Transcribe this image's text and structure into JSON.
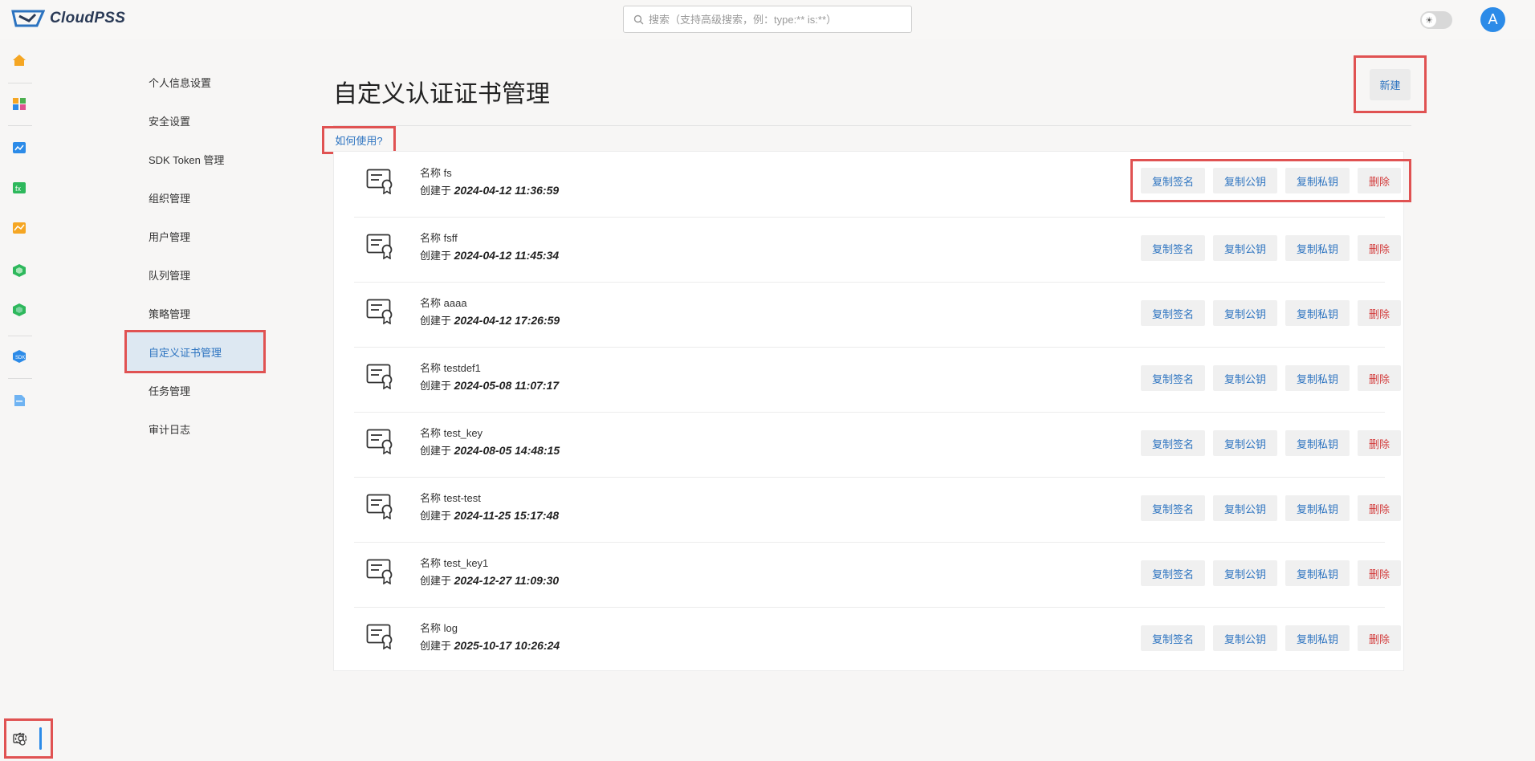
{
  "app": {
    "logo_text": "CloudPSS"
  },
  "search": {
    "placeholder": "搜索（支持高级搜索，例：type:** is:**）"
  },
  "user": {
    "avatar_letter": "A"
  },
  "rail": {
    "icons": [
      "home-icon",
      "apps-icon",
      "workbench-icon",
      "function-icon",
      "analytics-icon",
      "model-icon",
      "resource-icon",
      "sdk-icon",
      "docs-icon",
      "settings-icon",
      "admin-settings-icon"
    ]
  },
  "subnav": {
    "items": [
      {
        "label": "个人信息设置"
      },
      {
        "label": "安全设置"
      },
      {
        "label": "SDK Token 管理"
      },
      {
        "label": "组织管理"
      },
      {
        "label": "用户管理"
      },
      {
        "label": "队列管理"
      },
      {
        "label": "策略管理"
      },
      {
        "label": "自定义证书管理",
        "active": true
      },
      {
        "label": "任务管理"
      },
      {
        "label": "审计日志"
      }
    ]
  },
  "main": {
    "title": "自定义认证证书管理",
    "new_label": "新建",
    "howto_label": "如何使用?",
    "name_prefix": "名称",
    "created_prefix": "创建于",
    "actions": {
      "copy_sign": "复制签名",
      "copy_pub": "复制公钥",
      "copy_priv": "复制私钥",
      "delete": "删除"
    },
    "certs": [
      {
        "name": "fs",
        "created": "2024-04-12 11:36:59"
      },
      {
        "name": "fsff",
        "created": "2024-04-12 11:45:34"
      },
      {
        "name": "aaaa",
        "created": "2024-04-12 17:26:59"
      },
      {
        "name": "testdef1",
        "created": "2024-05-08 11:07:17"
      },
      {
        "name": "test_key",
        "created": "2024-08-05 14:48:15"
      },
      {
        "name": "test-test",
        "created": "2024-11-25 15:17:48"
      },
      {
        "name": "test_key1",
        "created": "2024-12-27 11:09:30"
      },
      {
        "name": "log",
        "created": "2025-10-17 10:26:24"
      }
    ]
  },
  "colors": {
    "accent": "#2c73c0",
    "danger": "#d23a3a",
    "highlight": "#e05252",
    "avatar": "#2c8be8"
  }
}
